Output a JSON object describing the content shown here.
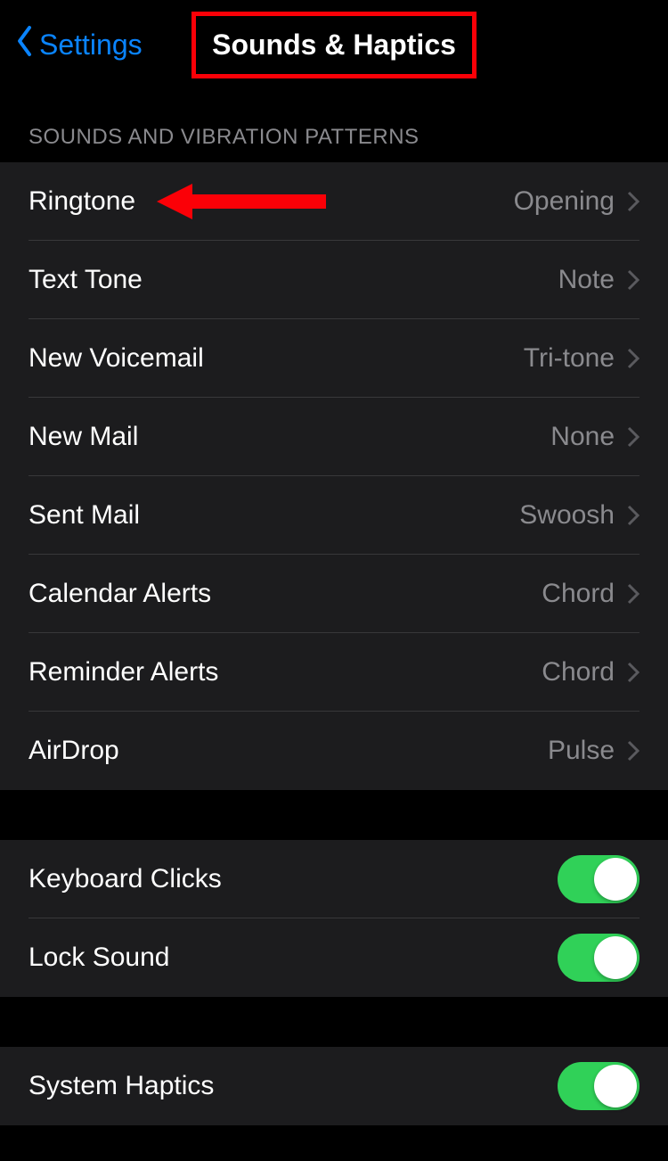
{
  "nav": {
    "back_label": "Settings",
    "title": "Sounds & Haptics"
  },
  "section_header": "SOUNDS AND VIBRATION PATTERNS",
  "sound_rows": [
    {
      "label": "Ringtone",
      "value": "Opening",
      "highlight_arrow": true
    },
    {
      "label": "Text Tone",
      "value": "Note"
    },
    {
      "label": "New Voicemail",
      "value": "Tri-tone"
    },
    {
      "label": "New Mail",
      "value": "None"
    },
    {
      "label": "Sent Mail",
      "value": "Swoosh"
    },
    {
      "label": "Calendar Alerts",
      "value": "Chord"
    },
    {
      "label": "Reminder Alerts",
      "value": "Chord"
    },
    {
      "label": "AirDrop",
      "value": "Pulse"
    }
  ],
  "toggle_rows_1": [
    {
      "label": "Keyboard Clicks",
      "on": true
    },
    {
      "label": "Lock Sound",
      "on": true
    }
  ],
  "toggle_rows_2": [
    {
      "label": "System Haptics",
      "on": true
    }
  ],
  "colors": {
    "accent": "#0a84ff",
    "annotation": "#fb0007",
    "toggle_on": "#30d158"
  }
}
